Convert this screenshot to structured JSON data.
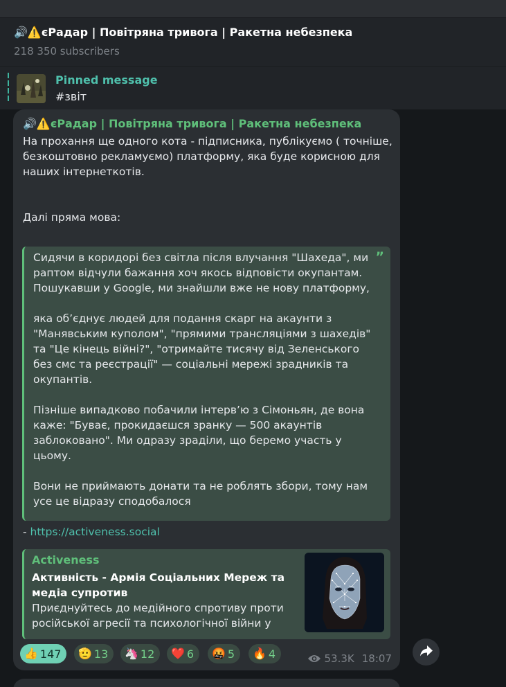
{
  "header": {
    "title": "🔊⚠️єРадар | Повітряна тривога | Ракетна небезпека",
    "subscribers": "218 350 subscribers"
  },
  "pinned": {
    "label": "Pinned message",
    "text": "#звіт"
  },
  "post": {
    "channel": "🔊⚠️єРадар | Повітряна тривога | Ракетна небезпека",
    "intro": "На прохання ще одного кота - підписника, публікуємо ( точніше, безкоштовно рекламуємо) платформу, яка буде корисною для наших інтернеткотів.",
    "direct_speech": "Далі пряма мова:",
    "quote": {
      "p1": "Сидячи в коридорі без світла після влучання \"Шахеда\", ми раптом відчули бажання хоч якось відповісти окупантам. Пошукавши у Google, ми знайшли вже не нову платформу,",
      "p2": "яка об’єднує людей для подання скарг на акаунти з \"Манявським куполом\", \"прямими трансляціями з шахедів\" та \"Це кінець війні?\", \"отримайте тисячу від Зеленського без смс та реєстрації\" — соціальні мережі зрадників та окупантів.",
      "p3": "Пізніше випадково побачили інтерв’ю з Сімоньян, де вона каже: \"Буває, прокидаєшся зранку — 500 акаунтів заблоковано\". Ми одразу зраділи, що беремо участь у цьому.",
      "p4": "Вони не приймають донати та не роблять збори, тому нам усе це відразу сподобалося"
    },
    "link_prefix": "- ",
    "link": "https://activeness.social",
    "preview": {
      "site": "Activeness",
      "title": "Активність - Армія Соціальних Мереж та медіа супротив",
      "description": "Приєднуйтесь до медійного спротиву проти російської агресії та психологічної війни у св..."
    },
    "reactions": [
      {
        "emoji": "👍",
        "count": "147"
      },
      {
        "emoji": "🫡",
        "count": "13"
      },
      {
        "emoji": "🦄",
        "count": "12"
      },
      {
        "emoji": "❤️",
        "count": "6"
      },
      {
        "emoji": "🤬",
        "count": "5"
      },
      {
        "emoji": "🔥",
        "count": "4"
      }
    ],
    "views": "53.3K",
    "time": "18:07"
  },
  "colors": {
    "accent_green": "#5fbf7a",
    "link_teal": "#4fc0ac",
    "bubble_bg": "#2b2f33",
    "quote_bg": "#3b4d45"
  },
  "icons": [
    "eye-icon",
    "share-icon",
    "quote-icon"
  ]
}
